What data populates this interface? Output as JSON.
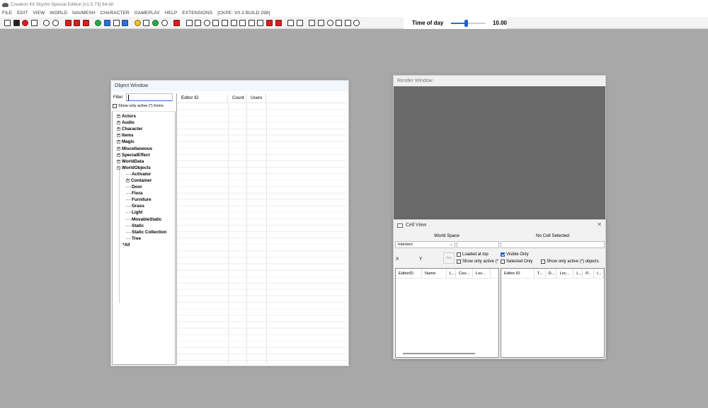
{
  "app": {
    "title": "Creation Kit Skyrim Special Edition [v1.5.73] 64-bit"
  },
  "menu": [
    "FILE",
    "EDIT",
    "VIEW",
    "WORLD",
    "NAVMESH",
    "CHARACTER",
    "GAMEPLAY",
    "HELP",
    "EXTENSIONS",
    "[CKPE: V0.3 BUILD 298]"
  ],
  "toolbar": {
    "time_of_day_label": "Time of day",
    "time_of_day_value": "10.00",
    "time_of_day_fraction": 0.417
  },
  "object_window": {
    "title": "Object Window",
    "filter_label": "Filter",
    "filter_value": "",
    "show_only_active": "Show only active (*) forms",
    "columns": [
      "Editor ID",
      "Count",
      "Users"
    ],
    "tree": [
      {
        "label": "Actors",
        "level": 0,
        "expander": "+"
      },
      {
        "label": "Audio",
        "level": 0,
        "expander": "+"
      },
      {
        "label": "Character",
        "level": 0,
        "expander": "+"
      },
      {
        "label": "Items",
        "level": 0,
        "expander": "+"
      },
      {
        "label": "Magic",
        "level": 0,
        "expander": "+"
      },
      {
        "label": "Miscellaneous",
        "level": 0,
        "expander": "+"
      },
      {
        "label": "SpecialEffect",
        "level": 0,
        "expander": "+"
      },
      {
        "label": "WorldData",
        "level": 0,
        "expander": "+"
      },
      {
        "label": "WorldObjects",
        "level": 0,
        "expander": "-"
      },
      {
        "label": "Activator",
        "level": 1,
        "expander": ""
      },
      {
        "label": "Container",
        "level": 1,
        "expander": "+"
      },
      {
        "label": "Door",
        "level": 1,
        "expander": ""
      },
      {
        "label": "Flora",
        "level": 1,
        "expander": ""
      },
      {
        "label": "Furniture",
        "level": 1,
        "expander": ""
      },
      {
        "label": "Grass",
        "level": 1,
        "expander": ""
      },
      {
        "label": "Light",
        "level": 1,
        "expander": ""
      },
      {
        "label": "MovableStatic",
        "level": 1,
        "expander": ""
      },
      {
        "label": "Static",
        "level": 1,
        "expander": ""
      },
      {
        "label": "Static Collection",
        "level": 1,
        "expander": ""
      },
      {
        "label": "Tree",
        "level": 1,
        "expander": ""
      },
      {
        "label": "*All",
        "level": 0,
        "expander": ""
      }
    ]
  },
  "render_window": {
    "title": "Render Window"
  },
  "cell_view": {
    "title": "Cell View",
    "world_space_label": "World Space",
    "no_cell_selected": "No Cell Selected",
    "world_space_value": "Interiors",
    "x_label": "X",
    "y_label": "Y",
    "go_button": "Go",
    "loaded_at_top": "Loaded at top",
    "show_only_active_short": "Show only active (*",
    "visible_only": "Visible Only",
    "selected_only": "Selected Only",
    "show_only_active_objects": "Show only active (*) objects",
    "left_columns": [
      "EditorID",
      "Name",
      "L...",
      "Coo...",
      "Loc..."
    ],
    "right_columns": [
      "Editor ID",
      "T...",
      "D...",
      "Loc...",
      "L...",
      "P...",
      "I..."
    ]
  }
}
